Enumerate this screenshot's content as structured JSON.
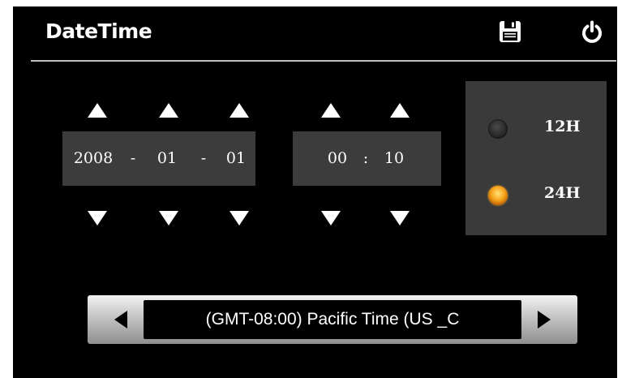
{
  "header": {
    "title": "DateTime"
  },
  "date": {
    "year": "2008",
    "month": "01",
    "day": "01",
    "separator": "-"
  },
  "time": {
    "hour": "00",
    "minute": "10",
    "separator": ":"
  },
  "hour_format": {
    "options": [
      "12H",
      "24H"
    ],
    "selected": "24H"
  },
  "timezone": {
    "value": "(GMT-08:00) Pacific Time (US _C"
  },
  "colors": {
    "background": "#000000",
    "field_bg": "#3c3c3c",
    "selected_radio": "#f6a21a"
  }
}
